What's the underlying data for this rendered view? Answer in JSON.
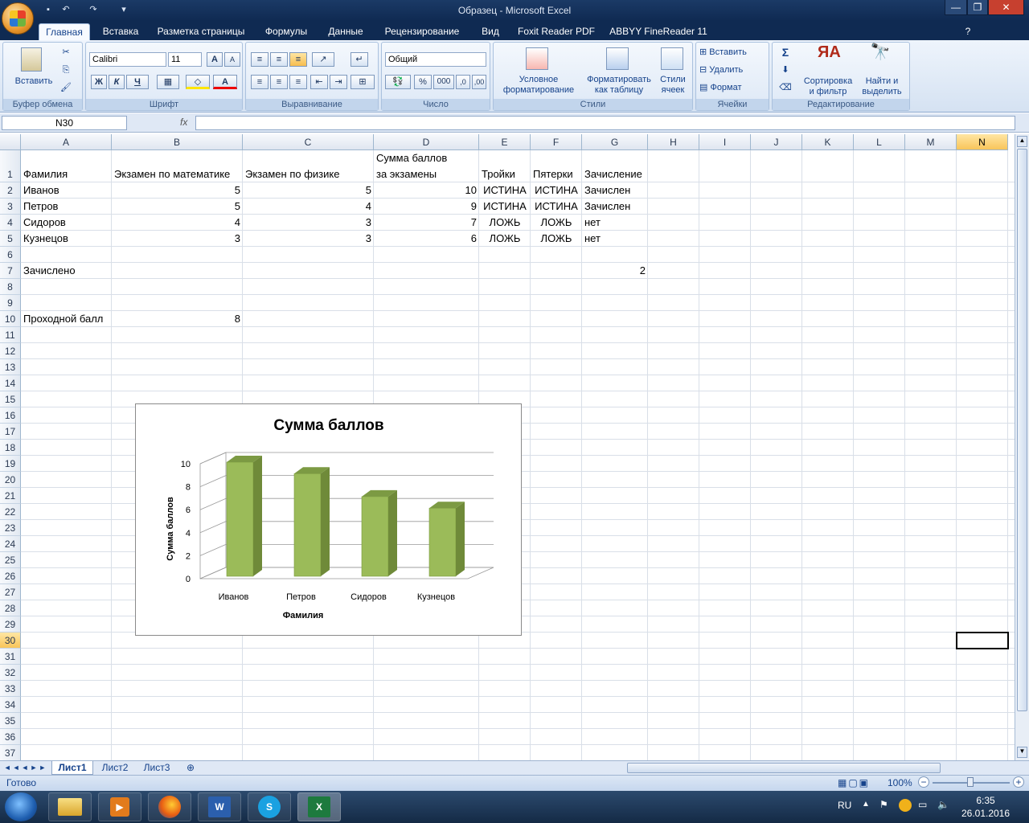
{
  "window": {
    "title": "Образец - Microsoft Excel",
    "minimize": "—",
    "restore": "❐",
    "close": "✕"
  },
  "tabs": [
    "Главная",
    "Вставка",
    "Разметка страницы",
    "Формулы",
    "Данные",
    "Рецензирование",
    "Вид",
    "Foxit Reader PDF",
    "ABBYY FineReader 11"
  ],
  "ribbon": {
    "clipboard": {
      "paste": "Вставить",
      "label": "Буфер обмена"
    },
    "font": {
      "name": "Calibri",
      "size": "11",
      "bold": "Ж",
      "italic": "К",
      "underline": "Ч",
      "grow": "A",
      "shrink": "A",
      "color_letter": "A",
      "label": "Шрифт"
    },
    "alignment": {
      "label": "Выравнивание"
    },
    "number": {
      "format": "Общий",
      "percent": "%",
      "thousands": "000",
      "label": "Число"
    },
    "styles": {
      "conditional_1": "Условное",
      "conditional_2": "форматирование",
      "as_table_1": "Форматировать",
      "as_table_2": "как таблицу",
      "cell_styles_1": "Стили",
      "cell_styles_2": "ячеек",
      "label": "Стили"
    },
    "cells": {
      "insert": "Вставить",
      "delete": "Удалить",
      "format": "Формат",
      "label": "Ячейки"
    },
    "editing": {
      "sigma": "Σ",
      "sort_1": "Сортировка",
      "sort_2": "и фильтр",
      "find_1": "Найти и",
      "find_2": "выделить",
      "label": "Редактирование"
    }
  },
  "formula_bar": {
    "name_box": "N30",
    "fx": "fx",
    "formula": ""
  },
  "columns": [
    "A",
    "B",
    "C",
    "D",
    "E",
    "F",
    "G",
    "H",
    "I",
    "J",
    "K",
    "L",
    "M",
    "N"
  ],
  "rows": [
    "1",
    "2",
    "3",
    "4",
    "5",
    "6",
    "7",
    "8",
    "9",
    "10",
    "11",
    "12",
    "13",
    "14",
    "15",
    "16",
    "17",
    "18",
    "19",
    "20",
    "21",
    "22",
    "23",
    "24",
    "25",
    "26",
    "27",
    "28",
    "29",
    "30",
    "31",
    "32",
    "33",
    "34",
    "35",
    "36",
    "37"
  ],
  "sheet": {
    "header": {
      "A": "Фамилия",
      "B": "Экзамен по математике",
      "C": "Экзамен по физике",
      "D_line1": "Сумма баллов",
      "D_line2": "за экзамены",
      "E": "Тройки",
      "F": "Пятерки",
      "G": "Зачисление"
    },
    "data": [
      {
        "name": "Иванов",
        "math": "5",
        "phys": "5",
        "sum": "10",
        "threes": "ИСТИНА",
        "fives": "ИСТИНА",
        "enroll": "Зачислен"
      },
      {
        "name": "Петров",
        "math": "5",
        "phys": "4",
        "sum": "9",
        "threes": "ИСТИНА",
        "fives": "ИСТИНА",
        "enroll": "Зачислен"
      },
      {
        "name": "Сидоров",
        "math": "4",
        "phys": "3",
        "sum": "7",
        "threes": "ЛОЖЬ",
        "fives": "ЛОЖЬ",
        "enroll": "нет"
      },
      {
        "name": "Кузнецов",
        "math": "3",
        "phys": "3",
        "sum": "6",
        "threes": "ЛОЖЬ",
        "fives": "ЛОЖЬ",
        "enroll": "нет"
      }
    ],
    "enrolled_label": "Зачислено",
    "enrolled_value": "2",
    "pass_label": "Проходной балл",
    "pass_value": "8"
  },
  "chart_data": {
    "type": "bar",
    "title": "Сумма баллов",
    "xlabel": "Фамилия",
    "ylabel": "Сумма баллов",
    "categories": [
      "Иванов",
      "Петров",
      "Сидоров",
      "Кузнецов"
    ],
    "values": [
      10,
      9,
      7,
      6
    ],
    "ylim": [
      0,
      10
    ],
    "yticks": [
      "0",
      "2",
      "4",
      "6",
      "8",
      "10"
    ],
    "bar_color": "#9bbb59",
    "grid": true,
    "legend": "none",
    "style": "3d-column"
  },
  "sheet_tabs": [
    "Лист1",
    "Лист2",
    "Лист3"
  ],
  "status": {
    "ready": "Готово",
    "zoom": "100%",
    "zoom_minus": "−",
    "zoom_plus": "+"
  },
  "taskbar": {
    "lang": "RU",
    "time": "6:35",
    "date": "26.01.2016"
  }
}
